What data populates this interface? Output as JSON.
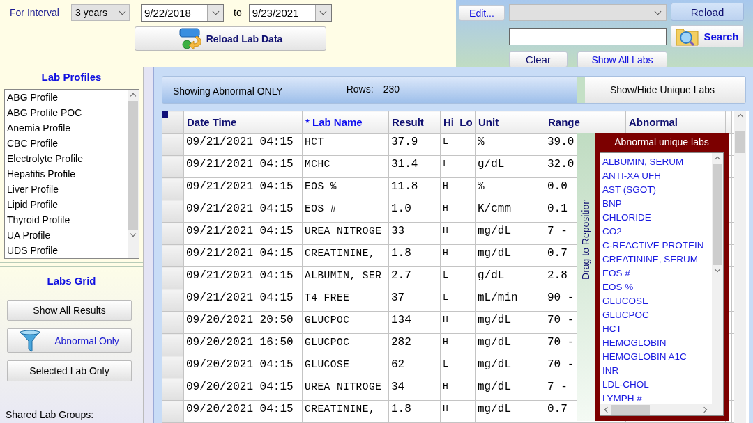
{
  "interval": {
    "label": "For Interval",
    "value": "3 years",
    "from": "9/22/2018",
    "to_label": "to",
    "to": "9/23/2021",
    "reload_button": "Reload Lab Data"
  },
  "search_panel": {
    "edit_button": "Edit...",
    "reload_button": "Reload",
    "search_button": "Search",
    "clear_button": "Clear",
    "show_all_button": "Show All Labs"
  },
  "sidebar": {
    "profiles_title": "Lab Profiles",
    "profiles": [
      "ABG Profile",
      "ABG Profile POC",
      "Anemia Profile",
      "CBC Profile",
      "Electrolyte Profile",
      "Hepatitis Profile",
      "Liver Profile",
      "Lipid Profile",
      "Thyroid Profile",
      "UA Profile",
      "UDS Profile"
    ],
    "grid_title": "Labs Grid",
    "buttons": [
      {
        "label": "Show All Results",
        "kind": "plain"
      },
      {
        "label": "Abnormal Only",
        "kind": "filter"
      },
      {
        "label": "Selected Lab Only",
        "kind": "plain"
      }
    ],
    "shared_label": "Shared Lab Groups:"
  },
  "grid": {
    "status": "Showing Abnormal ONLY",
    "rows_label": "Rows:",
    "rows_count": "230",
    "toggle_button": "Show/Hide Unique Labs",
    "columns": [
      "Date Time",
      "* Lab Name",
      "Result",
      "Hi_Lo",
      "Unit",
      "Range",
      "Abnormal"
    ],
    "rows": [
      [
        "09/21/2021 04:15",
        "HCT",
        "37.9",
        "L",
        "%",
        "39.0"
      ],
      [
        "09/21/2021 04:15",
        "MCHC",
        "31.4",
        "L",
        "g/dL",
        "32.0"
      ],
      [
        "09/21/2021 04:15",
        "EOS %",
        "11.8",
        "H",
        "%",
        "0.0"
      ],
      [
        "09/21/2021 04:15",
        "EOS #",
        "1.0",
        "H",
        "K/cmm",
        "0.1"
      ],
      [
        "09/21/2021 04:15",
        "UREA NITROGE",
        "33",
        "H",
        "mg/dL",
        "7 -"
      ],
      [
        "09/21/2021 04:15",
        "CREATININE,",
        "1.8",
        "H",
        "mg/dL",
        "0.7"
      ],
      [
        "09/21/2021 04:15",
        "ALBUMIN, SER",
        "2.7",
        "L",
        "g/dL",
        "2.8"
      ],
      [
        "09/21/2021 04:15",
        "T4 FREE",
        "37",
        "L",
        "mL/min",
        "90 -"
      ],
      [
        "09/20/2021 20:50",
        "GLUCPOC",
        "134",
        "H",
        "mg/dL",
        "70 -"
      ],
      [
        "09/20/2021 16:50",
        "GLUCPOC",
        "282",
        "H",
        "mg/dL",
        "70 -"
      ],
      [
        "09/20/2021 04:15",
        "GLUCOSE",
        "62",
        "L",
        "mg/dL",
        "70 -"
      ],
      [
        "09/20/2021 04:15",
        "UREA NITROGE",
        "34",
        "H",
        "mg/dL",
        "7 -"
      ],
      [
        "09/20/2021 04:15",
        "CREATININE,",
        "1.8",
        "H",
        "mg/dL",
        "0.7"
      ]
    ]
  },
  "popup": {
    "handle": "Drag to Reposition",
    "title": "Abnormal unique labs",
    "items": [
      "ALBUMIN, SERUM",
      "ANTI-XA UFH",
      "AST (SGOT)",
      "BNP",
      "CHLORIDE",
      "CO2",
      "C-REACTIVE PROTEIN",
      "CREATININE, SERUM",
      "EOS #",
      "EOS %",
      "GLUCOSE",
      "GLUCPOC",
      "HCT",
      "HEMOGLOBIN",
      "HEMOGLOBIN A1C",
      "INR",
      "LDL-CHOL",
      "LYMPH #"
    ]
  }
}
